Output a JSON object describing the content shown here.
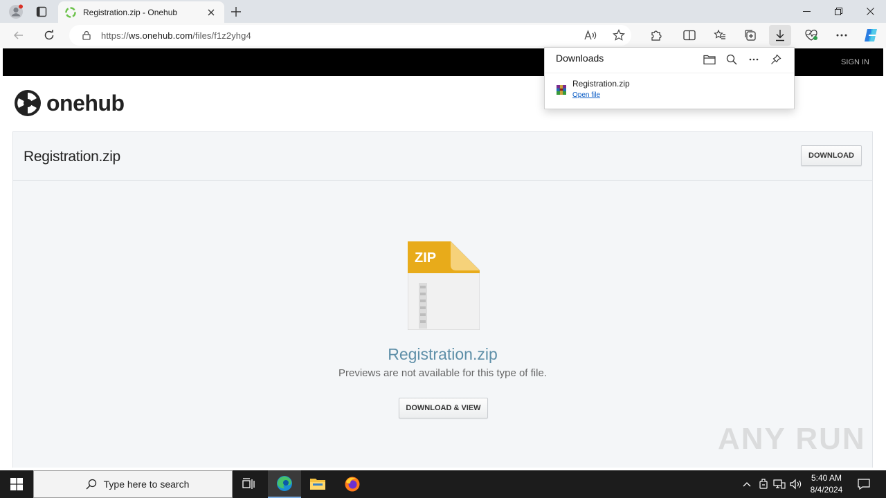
{
  "browser": {
    "tab_title": "Registration.zip - Onehub",
    "url_prefix": "https://",
    "url_host": "ws.onehub.com",
    "url_path": "/files/f1z2yhg4"
  },
  "downloads": {
    "title": "Downloads",
    "file_name": "Registration.zip",
    "open_label": "Open file"
  },
  "site": {
    "signin": "SIGN IN",
    "logo_text": "onehub",
    "file_title": "Registration.zip",
    "download_button": "DOWNLOAD",
    "zip_label": "ZIP",
    "preview_name": "Registration.zip",
    "preview_message": "Previews are not available for this type of file.",
    "download_view_button": "DOWNLOAD & VIEW"
  },
  "watermark": {
    "text": "ANY RUN"
  },
  "taskbar": {
    "search_placeholder": "Type here to search",
    "time": "5:40 AM",
    "date": "8/4/2024"
  },
  "colors": {
    "accent_link": "#0a5cc5",
    "preview_title": "#5e8fa8",
    "zip_yellow": "#e8ab1a"
  }
}
